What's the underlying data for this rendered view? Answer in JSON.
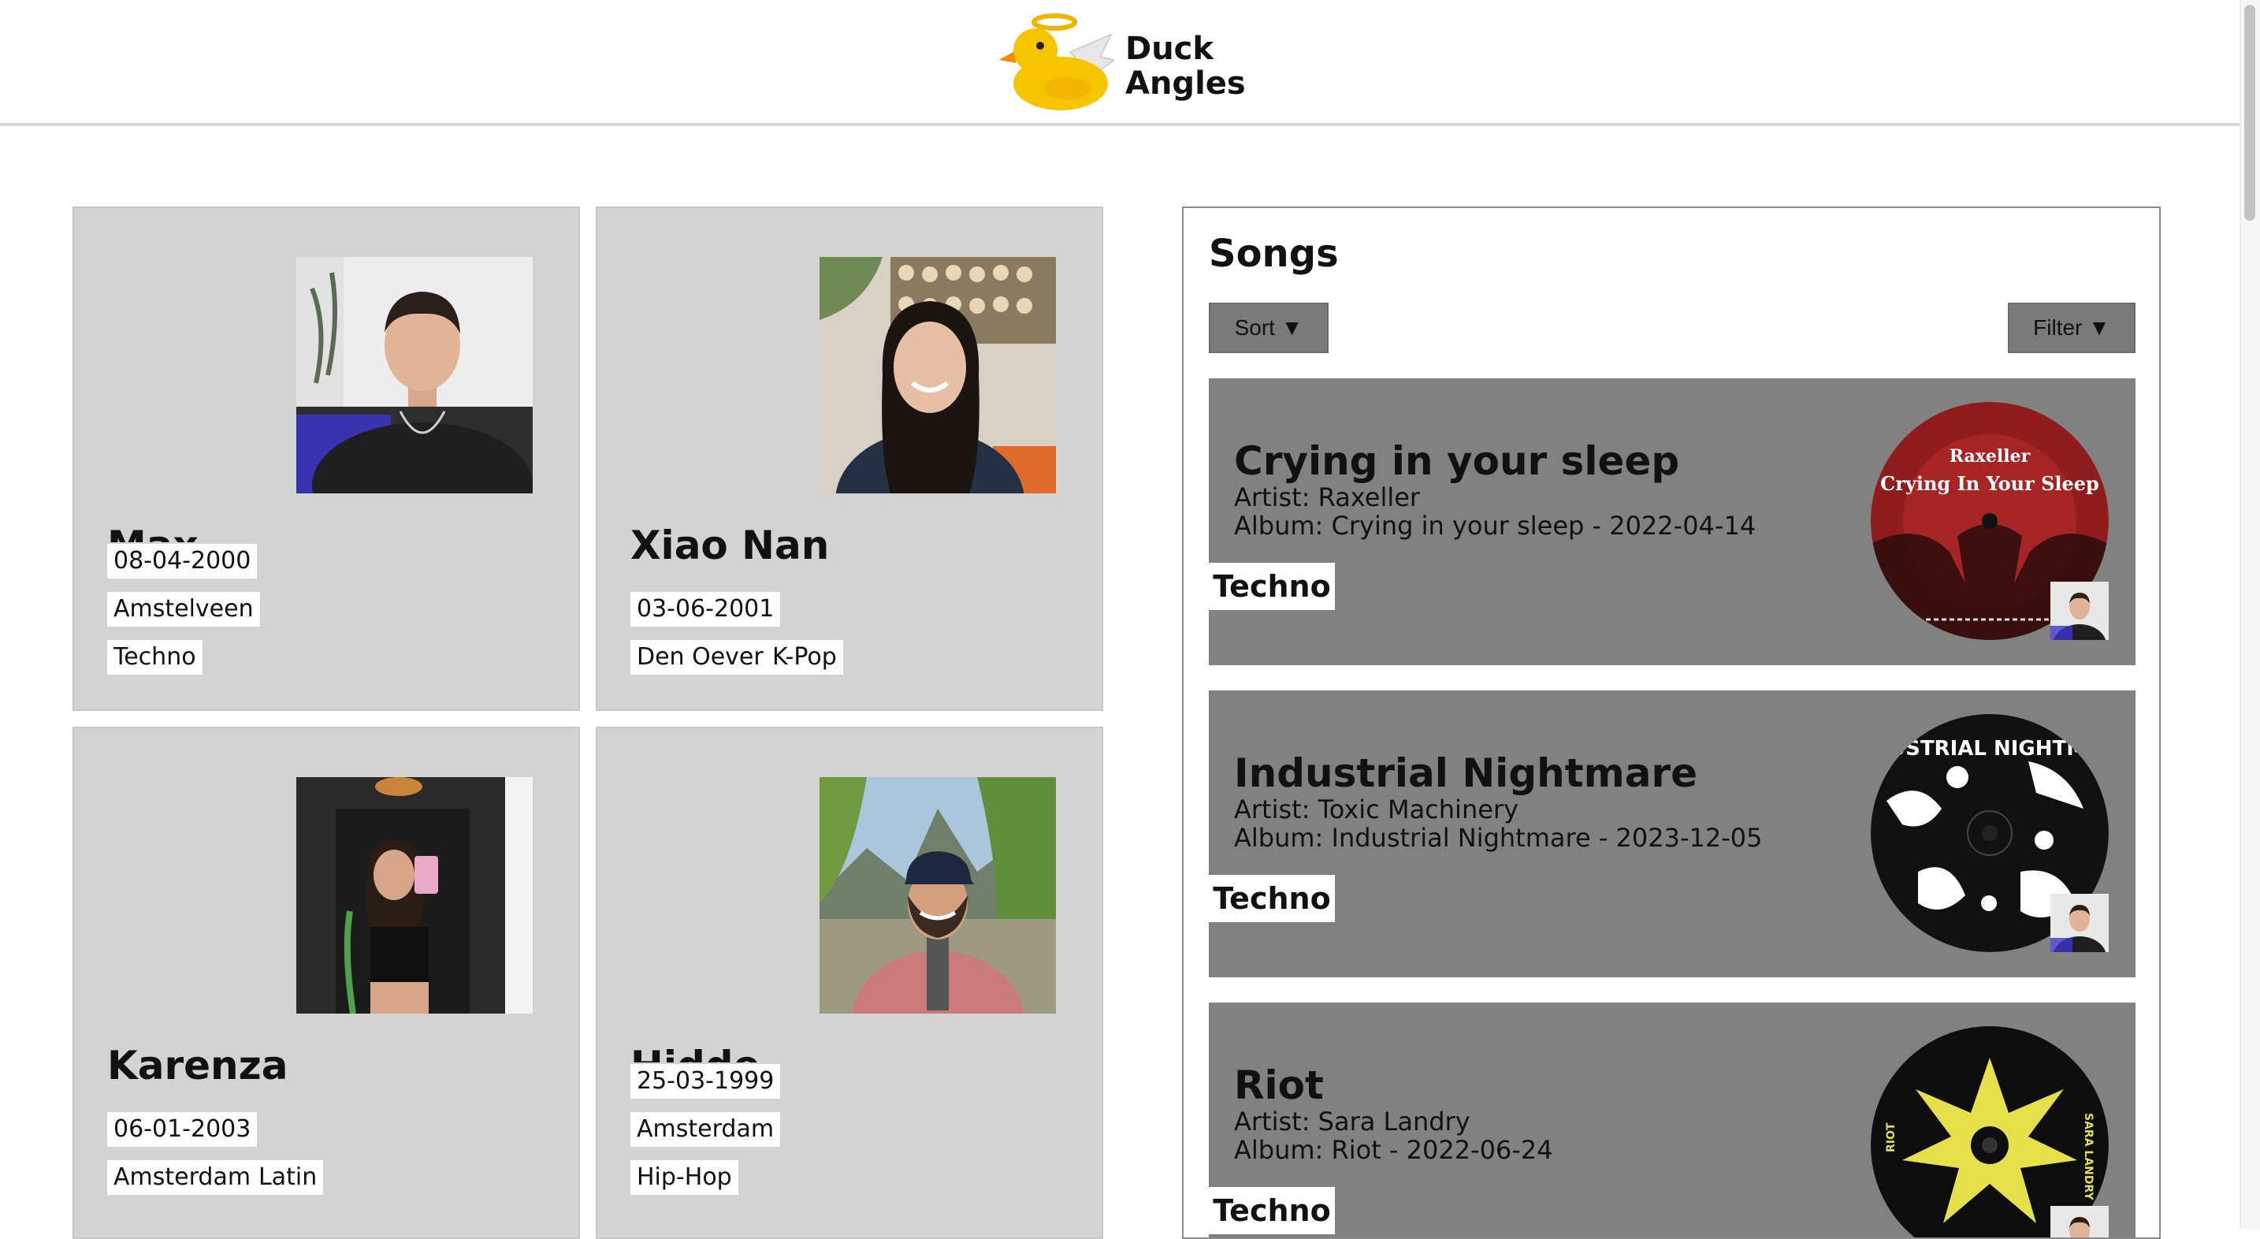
{
  "header": {
    "logo_alt": "duck-angel-logo",
    "brand_line1": "Duck",
    "brand_line2": "Angles"
  },
  "profiles": [
    {
      "name": "Max",
      "date": "08-04-2000",
      "city": "Amstelveen",
      "genres": [
        "Techno"
      ]
    },
    {
      "name": "Xiao Nan",
      "date": "03-06-2001",
      "city": "Den Oever",
      "genres": [
        "K-Pop"
      ]
    },
    {
      "name": "Karenza",
      "date": "06-01-2003",
      "city": "Amsterdam",
      "genres": [
        "Latin"
      ]
    },
    {
      "name": "Hidde",
      "date": "25-03-1999",
      "city": "Amsterdam",
      "genres": [
        "Hip-Hop"
      ]
    }
  ],
  "songs_panel": {
    "title": "Songs",
    "sort_label": "Sort ▼",
    "filter_label": "Filter ▼",
    "songs": [
      {
        "title": "Crying in your sleep",
        "artist": "Artist: Raxeller",
        "album": "Album: Crying in your sleep - 2022-04-14",
        "genre": "Techno",
        "cover_text_1": "Raxeller",
        "cover_text_2": "Crying In Your Sleep"
      },
      {
        "title": "Industrial Nightmare",
        "artist": "Artist: Toxic Machinery",
        "album": "Album: Industrial Nightmare - 2023-12-05",
        "genre": "Techno",
        "cover_text_1": "INDUSTRIAL NIGHTMARE"
      },
      {
        "title": "Riot",
        "artist": "Artist: Sara Landry",
        "album": "Album: Riot - 2022-06-24",
        "genre": "Techno",
        "cover_text_1": "RIOT",
        "cover_text_2": "SARA LANDRY"
      }
    ]
  },
  "colors": {
    "card_bg": "#d3d3d3",
    "song_bg": "#818181",
    "button_bg": "#7a7a7a",
    "tag_bg": "#ffffff",
    "duck_yellow": "#f7c400"
  }
}
